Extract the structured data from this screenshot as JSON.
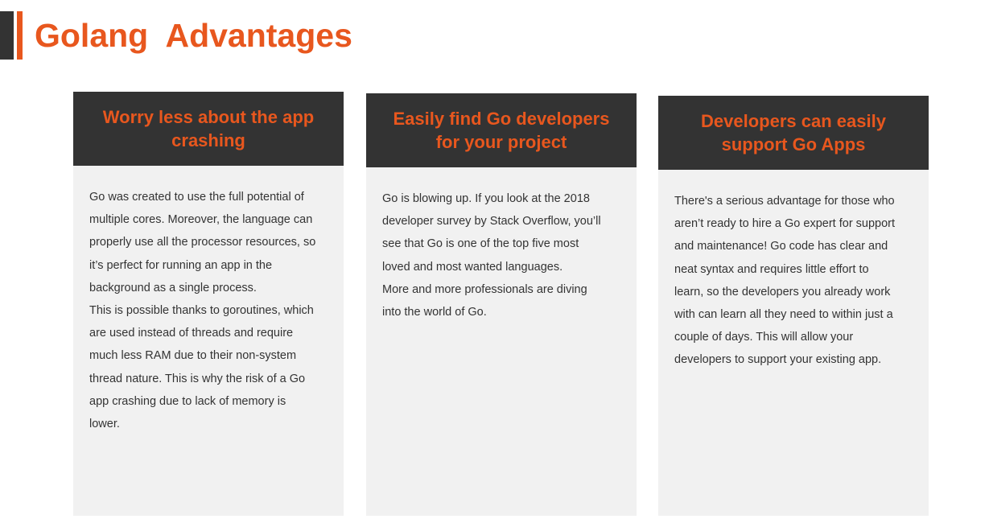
{
  "slide": {
    "title": "Golang  Advantages"
  },
  "cards": [
    {
      "heading": "Worry less about the app crashing",
      "lines": [
        "Go was created to use the full potential of",
        "multiple cores. Moreover, the language can",
        "properly use all the processor resources, so",
        "it’s perfect for running an app in the",
        "background as a single process.",
        "This is possible thanks to goroutines, which",
        "are used instead of threads and require",
        "much less RAM due to their non-system",
        "thread nature.  This is why the risk of a Go",
        "app crashing due to lack of memory is",
        "lower."
      ]
    },
    {
      "heading": "Easily find Go developers for your project",
      "lines": [
        "Go is blowing up. If you look at the 2018",
        "developer survey by Stack Overflow, you’ll",
        "see that Go is one of the top five most",
        "loved and most wanted languages.",
        "More and more professionals are diving",
        "into the world of Go."
      ]
    },
    {
      "heading": "Developers can easily support Go Apps",
      "lines": [
        "There's a serious advantage for those who",
        "aren’t ready to hire a Go expert for support",
        "and maintenance! Go code has clear and",
        "neat syntax and requires little effort to",
        "learn, so the developers you already work",
        "with can learn all they need to within just a",
        "couple of days. This will allow your",
        "developers to support your existing app."
      ]
    }
  ],
  "colors": {
    "accent": "#e8571e",
    "header_bg": "#333333",
    "card_bg": "#f1f1f1",
    "text": "#333333"
  }
}
